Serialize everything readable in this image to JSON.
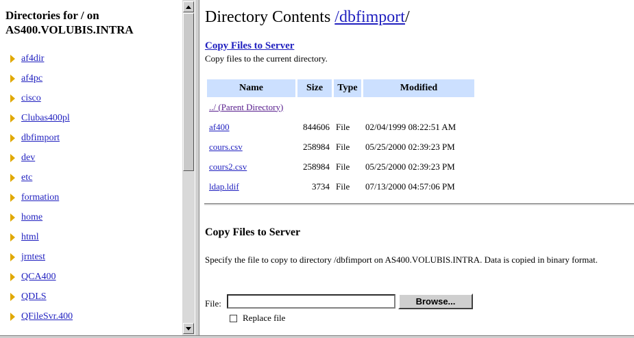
{
  "left": {
    "title_line1": "Directories for / on",
    "title_line2": "AS400.VOLUBIS.INTRA",
    "directories": [
      "af4dir",
      "af4pc",
      "cisco",
      "Clubas400pl",
      "dbfimport",
      "dev",
      "etc",
      "formation",
      "home",
      "html",
      "jrntest",
      "QCA400",
      "QDLS",
      "QFileSvr.400"
    ]
  },
  "right": {
    "title_prefix": "Directory Contents ",
    "title_link": "/dbfimport",
    "title_suffix": "/",
    "copy_link": "Copy Files to Server",
    "copy_desc": "Copy files to the current directory.",
    "table": {
      "headers": [
        "Name",
        "Size",
        "Type",
        "Modified"
      ],
      "parent": "../ (Parent Directory)",
      "rows": [
        {
          "name": "af400",
          "size": "844606",
          "type": "File",
          "modified": "02/04/1999 08:22:51 AM"
        },
        {
          "name": "cours.csv",
          "size": "258984",
          "type": "File",
          "modified": "05/25/2000 02:39:23 PM"
        },
        {
          "name": "cours2.csv",
          "size": "258984",
          "type": "File",
          "modified": "05/25/2000 02:39:23 PM"
        },
        {
          "name": "ldap.ldif",
          "size": "3734",
          "type": "File",
          "modified": "07/13/2000 04:57:06 PM"
        }
      ]
    },
    "section_title": "Copy Files to Server",
    "section_desc": "Specify the file to copy to directory /dbfimport on AS400.VOLUBIS.INTRA. Data is copied in binary format.",
    "file_label": "File:",
    "file_value": "",
    "browse_label": "Browse...",
    "replace_label": "Replace file"
  },
  "colors": {
    "link": "#1f1fbf",
    "visited": "#551a8b",
    "header_bg": "#cce0ff",
    "folder_arrow": "#e0a800"
  }
}
